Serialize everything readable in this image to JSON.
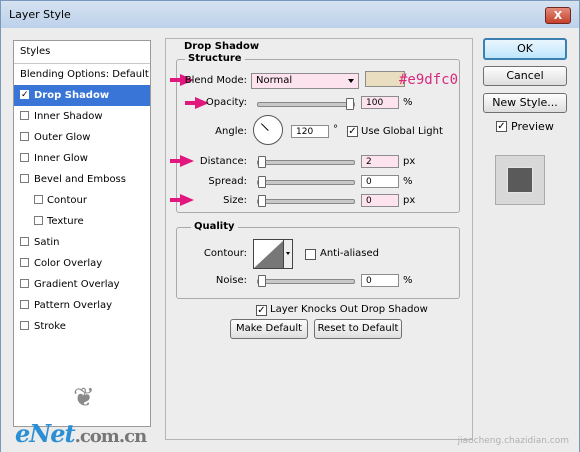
{
  "window": {
    "title": "Layer Style",
    "close_label": "X"
  },
  "styles_panel": {
    "header": "Styles",
    "items": [
      {
        "label": "Blending Options: Default",
        "type": "header"
      },
      {
        "label": "Drop Shadow",
        "checked": true,
        "selected": true
      },
      {
        "label": "Inner Shadow"
      },
      {
        "label": "Outer Glow"
      },
      {
        "label": "Inner Glow"
      },
      {
        "label": "Bevel and Emboss"
      },
      {
        "label": "Contour",
        "indent": true
      },
      {
        "label": "Texture",
        "indent": true
      },
      {
        "label": "Satin"
      },
      {
        "label": "Color Overlay"
      },
      {
        "label": "Gradient Overlay"
      },
      {
        "label": "Pattern Overlay"
      },
      {
        "label": "Stroke"
      }
    ]
  },
  "drop_shadow": {
    "title": "Drop Shadow",
    "structure": {
      "title": "Structure",
      "blend_mode_label": "Blend Mode:",
      "blend_mode_value": "Normal",
      "swatch_color": "#e9dfc0",
      "swatch_hex_label": "#e9dfc0",
      "opacity_label": "Opacity:",
      "opacity_value": "100",
      "opacity_unit": "%",
      "angle_label": "Angle:",
      "angle_value": "120",
      "angle_unit": "°",
      "use_global_light_label": "Use Global Light",
      "use_global_light_checked": true,
      "distance_label": "Distance:",
      "distance_value": "2",
      "distance_unit": "px",
      "spread_label": "Spread:",
      "spread_value": "0",
      "spread_unit": "%",
      "size_label": "Size:",
      "size_value": "0",
      "size_unit": "px"
    },
    "quality": {
      "title": "Quality",
      "contour_label": "Contour:",
      "anti_aliased_label": "Anti-aliased",
      "noise_label": "Noise:",
      "noise_value": "0",
      "noise_unit": "%"
    },
    "knocks_out_label": "Layer Knocks Out Drop Shadow",
    "make_default_label": "Make Default",
    "reset_default_label": "Reset to Default"
  },
  "actions": {
    "ok_label": "OK",
    "cancel_label": "Cancel",
    "new_style_label": "New Style...",
    "preview_label": "Preview",
    "preview_checked": true
  },
  "branding": {
    "logo_e": "e",
    "logo_net": "Net",
    "logo_domain": ".com.cn",
    "watermark": "jiaocheng.chazidian.com"
  },
  "accent_colors": {
    "selection": "#3875d7",
    "annotation": "#e2177e",
    "field_highlight": "#fce3ee"
  }
}
